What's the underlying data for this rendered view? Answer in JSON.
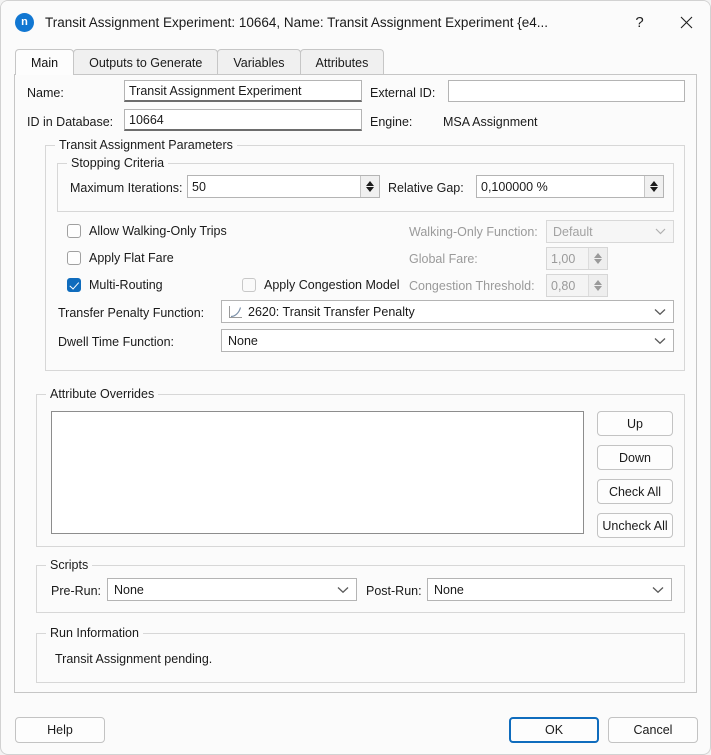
{
  "window": {
    "title": "Transit Assignment Experiment: 10664, Name: Transit Assignment Experiment  {e4...",
    "app_icon_letter": "n",
    "help_titlebar_label": "?",
    "accent_color": "#0f6cbd"
  },
  "tabs": [
    {
      "label": "Main",
      "active": true
    },
    {
      "label": "Outputs to Generate",
      "active": false
    },
    {
      "label": "Variables",
      "active": false
    },
    {
      "label": "Attributes",
      "active": false
    }
  ],
  "main": {
    "name_label": "Name:",
    "name_value": "Transit Assignment Experiment",
    "external_id_label": "External ID:",
    "external_id_value": "",
    "id_in_database_label": "ID in Database:",
    "id_in_database_value": "10664",
    "engine_label": "Engine:",
    "engine_value": "MSA Assignment"
  },
  "parameters": {
    "group_title": "Transit Assignment Parameters",
    "stopping_criteria": {
      "group_title": "Stopping Criteria",
      "max_iterations_label": "Maximum Iterations:",
      "max_iterations_value": "50",
      "relative_gap_label": "Relative Gap:",
      "relative_gap_value": "0,100000 %"
    },
    "checkboxes": {
      "allow_walking_only_label": "Allow Walking-Only Trips",
      "allow_walking_only_checked": false,
      "apply_flat_fare_label": "Apply Flat Fare",
      "apply_flat_fare_checked": false,
      "multi_routing_label": "Multi-Routing",
      "multi_routing_checked": true,
      "apply_congestion_model_label": "Apply Congestion Model",
      "apply_congestion_model_checked": false
    },
    "right_fields": {
      "walking_only_function_label": "Walking-Only Function:",
      "walking_only_function_value": "Default",
      "global_fare_label": "Global Fare:",
      "global_fare_value": "1,00",
      "congestion_threshold_label": "Congestion Threshold:",
      "congestion_threshold_value": "0,80"
    },
    "transfer_penalty_label": "Transfer Penalty Function:",
    "transfer_penalty_value": "2620: Transit Transfer Penalty",
    "transfer_penalty_icon": "curve-icon",
    "dwell_time_label": "Dwell Time Function:",
    "dwell_time_value": "None"
  },
  "attribute_overrides": {
    "group_title": "Attribute Overrides",
    "list_items": [],
    "buttons": [
      {
        "label": "Up"
      },
      {
        "label": "Down"
      },
      {
        "label": "Check All"
      },
      {
        "label": "Uncheck All"
      }
    ]
  },
  "scripts": {
    "group_title": "Scripts",
    "pre_run_label": "Pre-Run:",
    "pre_run_value": "None",
    "post_run_label": "Post-Run:",
    "post_run_value": "None"
  },
  "run_information": {
    "group_title": "Run Information",
    "message": "Transit Assignment pending."
  },
  "footer": {
    "help_label": "Help",
    "ok_label": "OK",
    "cancel_label": "Cancel"
  }
}
